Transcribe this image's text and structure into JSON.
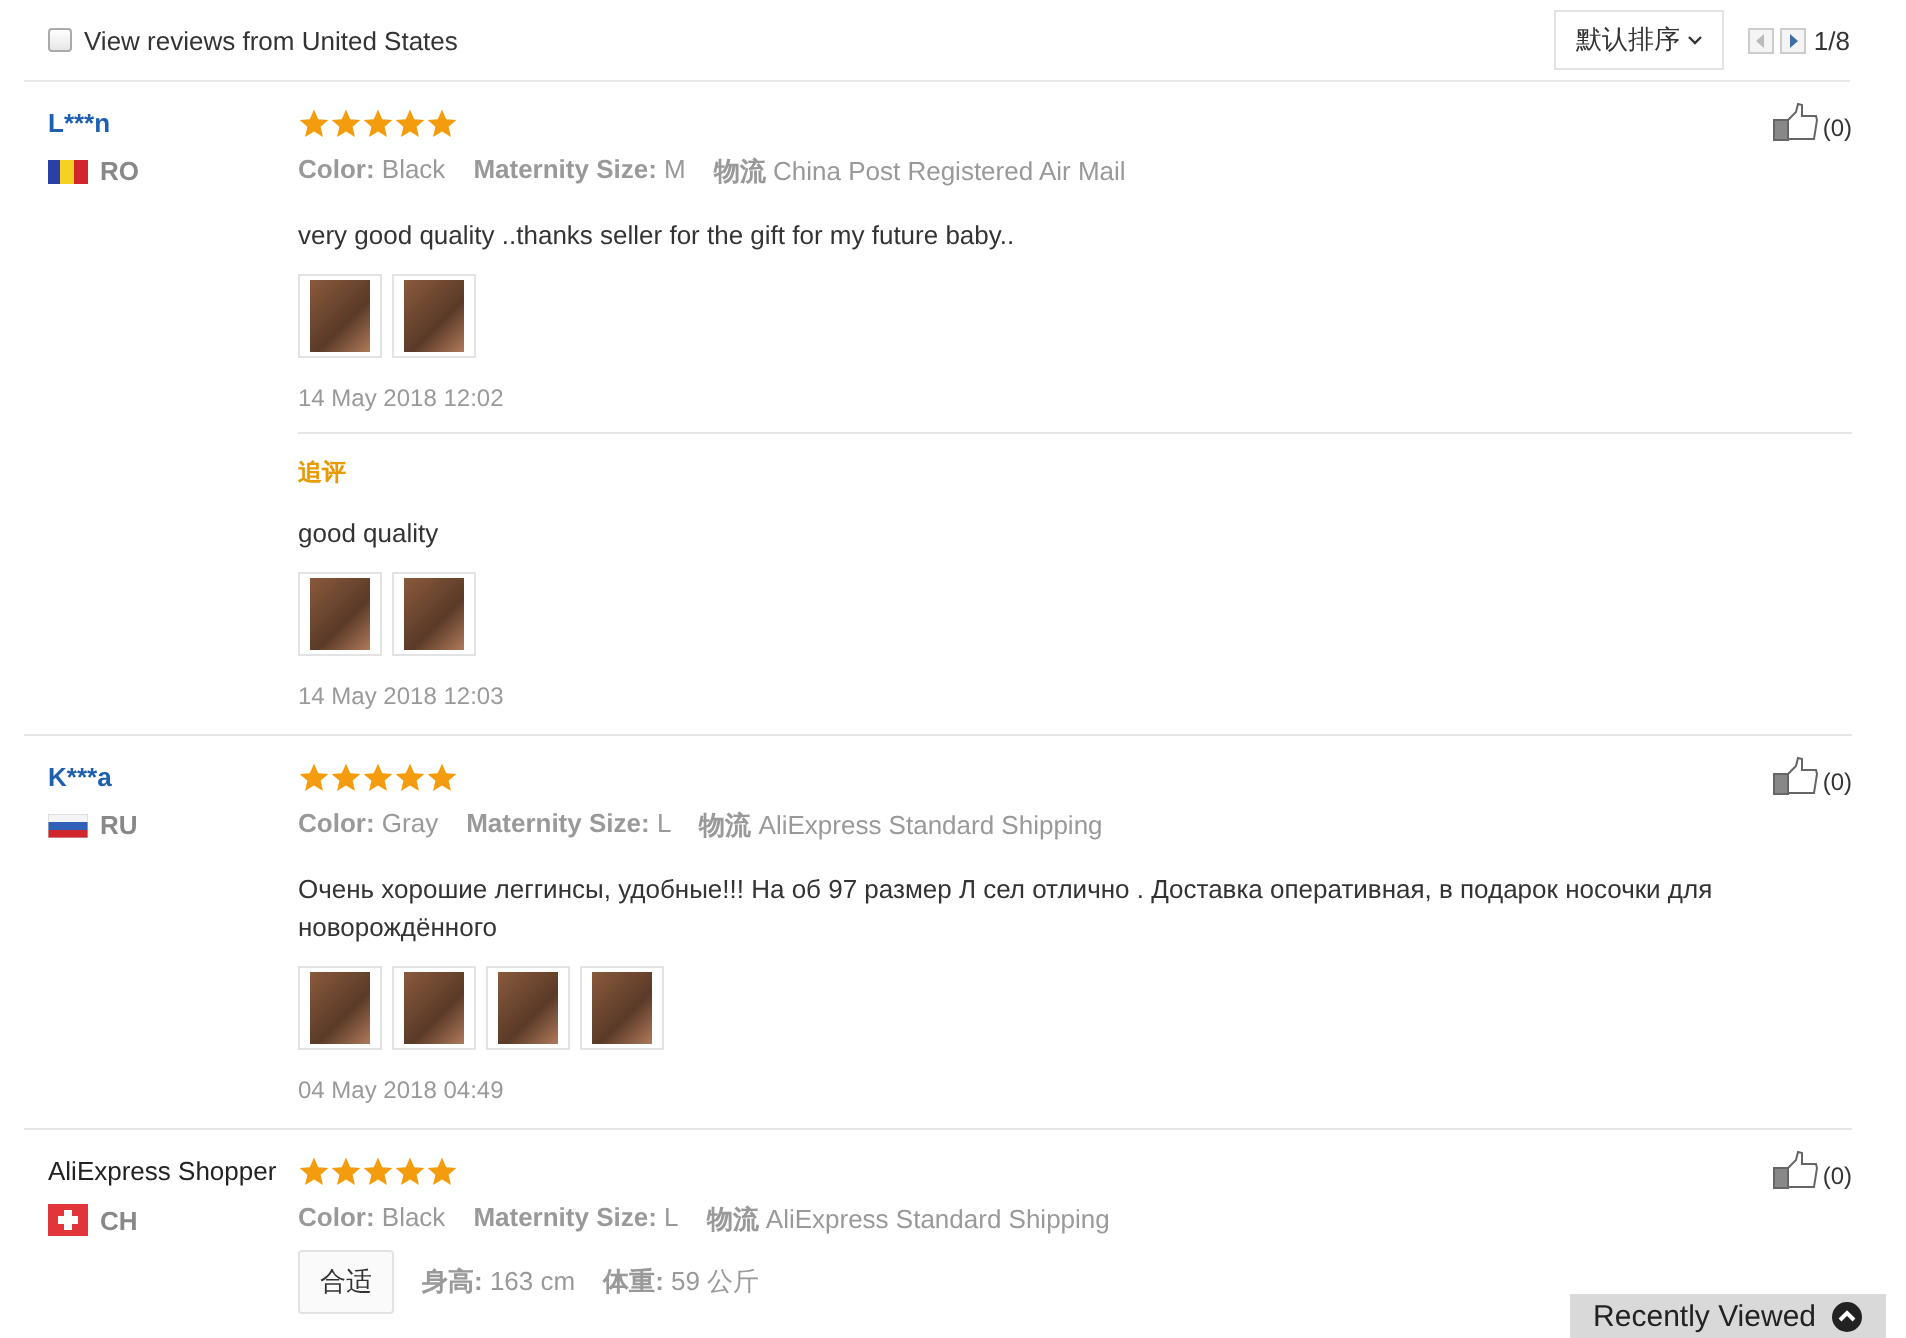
{
  "filter": {
    "label": "View reviews from United States",
    "checked": false
  },
  "sort": {
    "label": "默认排序"
  },
  "pager": {
    "prev_disabled": true,
    "next_disabled": false,
    "page": "1/8"
  },
  "reviews": [
    {
      "name": "L***n",
      "link": true,
      "flag": {
        "kind": "vertical-tricolor"
      },
      "country": "RO",
      "stars": 5,
      "attributes": [
        {
          "label": "Color:",
          "value": "Black"
        },
        {
          "label": "Maternity Size:",
          "value": "M"
        },
        {
          "label": "物流",
          "value": "China Post Registered Air Mail"
        }
      ],
      "text": "very good quality ..thanks seller for the gift for my future baby..",
      "photos": [
        {
          "kind": "photo"
        },
        {
          "kind": "photo"
        }
      ],
      "date": "14 May 2018 12:02",
      "likes": "(0)",
      "followup": {
        "label": "追评",
        "text": "good quality",
        "photos": [
          {
            "kind": "photo"
          },
          {
            "kind": "photo"
          }
        ],
        "date": "14 May 2018 12:03"
      }
    },
    {
      "name": "K***a",
      "link": true,
      "flag": {
        "kind": "horizontal-tricolor"
      },
      "country": "RU",
      "stars": 5,
      "attributes": [
        {
          "label": "Color:",
          "value": "Gray"
        },
        {
          "label": "Maternity Size:",
          "value": "L"
        },
        {
          "label": "物流",
          "value": "AliExpress Standard Shipping"
        }
      ],
      "text": "Очень хорошие леггинсы, удобные!!! На об 97 размер Л сел отлично . Доставка оперативная, в подарок носочки для новорождённого",
      "photos": [
        {
          "kind": "photo"
        },
        {
          "kind": "photo"
        },
        {
          "kind": "photo"
        },
        {
          "kind": "photo"
        }
      ],
      "date": "04 May 2018 04:49",
      "likes": "(0)"
    },
    {
      "name": "AliExpress Shopper",
      "link": false,
      "flag": {
        "kind": "cross"
      },
      "country": "CH",
      "stars": 5,
      "attributes": [
        {
          "label": "Color:",
          "value": "Black"
        },
        {
          "label": "Maternity Size:",
          "value": "L"
        },
        {
          "label": "物流",
          "value": "AliExpress Standard Shipping"
        }
      ],
      "fit": {
        "tag": "合适",
        "measures": [
          {
            "label": "身高:",
            "value": "163 cm"
          },
          {
            "label": "体重:",
            "value": "59 公斤"
          }
        ]
      },
      "likes": "(0)"
    }
  ],
  "recently_viewed": {
    "label": "Recently Viewed"
  }
}
